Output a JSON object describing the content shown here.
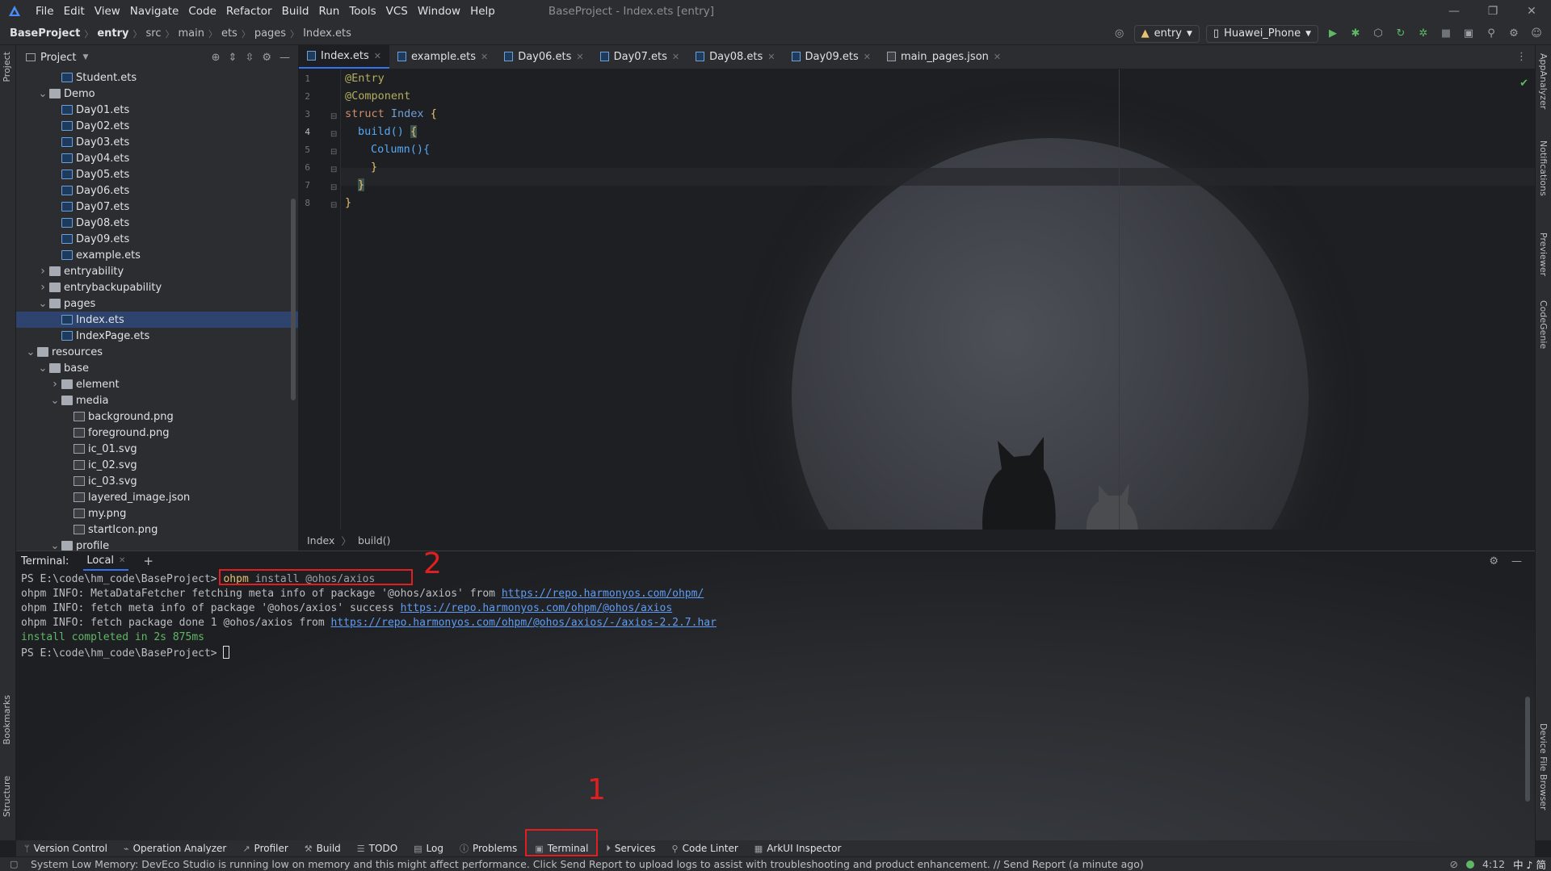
{
  "menubar": {
    "items": [
      "File",
      "Edit",
      "View",
      "Navigate",
      "Code",
      "Refactor",
      "Build",
      "Run",
      "Tools",
      "VCS",
      "Window",
      "Help"
    ],
    "window_title": "BaseProject - Index.ets [entry]"
  },
  "navbar": {
    "breadcrumbs": [
      "BaseProject",
      "entry",
      "src",
      "main",
      "ets",
      "pages",
      "Index.ets"
    ],
    "run_config": "entry",
    "device": "Huawei_Phone"
  },
  "left_strip": {
    "project": "Project",
    "bookmarks": "Bookmarks",
    "structure": "Structure"
  },
  "right_strip": {
    "app_analyzer": "AppAnalyzer",
    "notifications": "Notifications",
    "previewer": "Previewer",
    "code_genie": "CodeGenie",
    "device_file_browser": "Device File Browser"
  },
  "project_panel": {
    "title": "Project",
    "tree": [
      {
        "label": "Student.ets",
        "type": "file",
        "indent": 4
      },
      {
        "label": "Demo",
        "type": "folder",
        "indent": 3,
        "expanded": true
      },
      {
        "label": "Day01.ets",
        "type": "file",
        "indent": 4
      },
      {
        "label": "Day02.ets",
        "type": "file",
        "indent": 4
      },
      {
        "label": "Day03.ets",
        "type": "file",
        "indent": 4
      },
      {
        "label": "Day04.ets",
        "type": "file",
        "indent": 4
      },
      {
        "label": "Day05.ets",
        "type": "file",
        "indent": 4
      },
      {
        "label": "Day06.ets",
        "type": "file",
        "indent": 4
      },
      {
        "label": "Day07.ets",
        "type": "file",
        "indent": 4
      },
      {
        "label": "Day08.ets",
        "type": "file",
        "indent": 4
      },
      {
        "label": "Day09.ets",
        "type": "file",
        "indent": 4
      },
      {
        "label": "example.ets",
        "type": "file",
        "indent": 4
      },
      {
        "label": "entryability",
        "type": "folder",
        "indent": 3,
        "expanded": false
      },
      {
        "label": "entrybackupability",
        "type": "folder",
        "indent": 3,
        "expanded": false
      },
      {
        "label": "pages",
        "type": "folder",
        "indent": 3,
        "expanded": true
      },
      {
        "label": "Index.ets",
        "type": "file",
        "indent": 4,
        "selected": true
      },
      {
        "label": "IndexPage.ets",
        "type": "file",
        "indent": 4
      },
      {
        "label": "resources",
        "type": "folder",
        "indent": 2,
        "expanded": true
      },
      {
        "label": "base",
        "type": "folder",
        "indent": 3,
        "expanded": true
      },
      {
        "label": "element",
        "type": "folder",
        "indent": 4,
        "expanded": false
      },
      {
        "label": "media",
        "type": "folder",
        "indent": 4,
        "expanded": true
      },
      {
        "label": "background.png",
        "type": "image",
        "indent": 5
      },
      {
        "label": "foreground.png",
        "type": "image",
        "indent": 5
      },
      {
        "label": "ic_01.svg",
        "type": "image",
        "indent": 5
      },
      {
        "label": "ic_02.svg",
        "type": "image",
        "indent": 5
      },
      {
        "label": "ic_03.svg",
        "type": "image",
        "indent": 5
      },
      {
        "label": "layered_image.json",
        "type": "image",
        "indent": 5
      },
      {
        "label": "my.png",
        "type": "image",
        "indent": 5
      },
      {
        "label": "startIcon.png",
        "type": "image",
        "indent": 5
      },
      {
        "label": "profile",
        "type": "folder",
        "indent": 4,
        "expanded": true
      }
    ]
  },
  "editor": {
    "tabs": [
      "Index.ets",
      "example.ets",
      "Day06.ets",
      "Day07.ets",
      "Day08.ets",
      "Day09.ets",
      "main_pages.json"
    ],
    "active_tab": "Index.ets",
    "line_numbers": [
      "1",
      "2",
      "3",
      "4",
      "5",
      "6",
      "7",
      "8"
    ],
    "code": {
      "l1": "@Entry",
      "l2": "@Component",
      "l3_kw": "struct",
      "l3_name": "Index",
      "l3_brace": "{",
      "l4_fn": "build()",
      "l4_brace": "{",
      "l5_fn": "Column(){",
      "l6": "}",
      "l7": "}",
      "l8": "}"
    },
    "breadcrumb": [
      "Index",
      "build()"
    ]
  },
  "terminal": {
    "label": "Terminal:",
    "tab": "Local",
    "prompt1": "PS E:\\code\\hm_code\\BaseProject>",
    "cmd_name": "ohpm",
    "cmd_args": " install @ohos/axios",
    "line2_text": "ohpm INFO: MetaDataFetcher fetching meta info of package '@ohos/axios' from ",
    "line2_link": "https://repo.harmonyos.com/ohpm/",
    "line3_text": "ohpm INFO: fetch meta info of package '@ohos/axios' success ",
    "line3_link": "https://repo.harmonyos.com/ohpm/@ohos/axios",
    "line4_text": "ohpm INFO: fetch package done 1 @ohos/axios from ",
    "line4_link": "https://repo.harmonyos.com/ohpm/@ohos/axios/-/axios-2.2.7.har",
    "line5": "install completed in 2s 875ms",
    "prompt2": "PS E:\\code\\hm_code\\BaseProject>",
    "annotation_1": "1",
    "annotation_2": "2"
  },
  "toolwindows": [
    "Version Control",
    "Operation Analyzer",
    "Profiler",
    "Build",
    "TODO",
    "Log",
    "Problems",
    "Terminal",
    "Services",
    "Code Linter",
    "ArkUI Inspector"
  ],
  "statusbar": {
    "message": "System Low Memory: DevEco Studio is running low on memory and this might affect performance. Click Send Report to upload logs to assist with troubleshooting and product enhancement. // Send Report (a minute ago)",
    "position": "4:12",
    "ime": "中 ♪ 简"
  },
  "colors": {
    "accent": "#3574f0",
    "selection": "#2e436e",
    "annotation_red": "#e02020",
    "success_green": "#5fb865",
    "link_blue": "#5e9cf5"
  }
}
